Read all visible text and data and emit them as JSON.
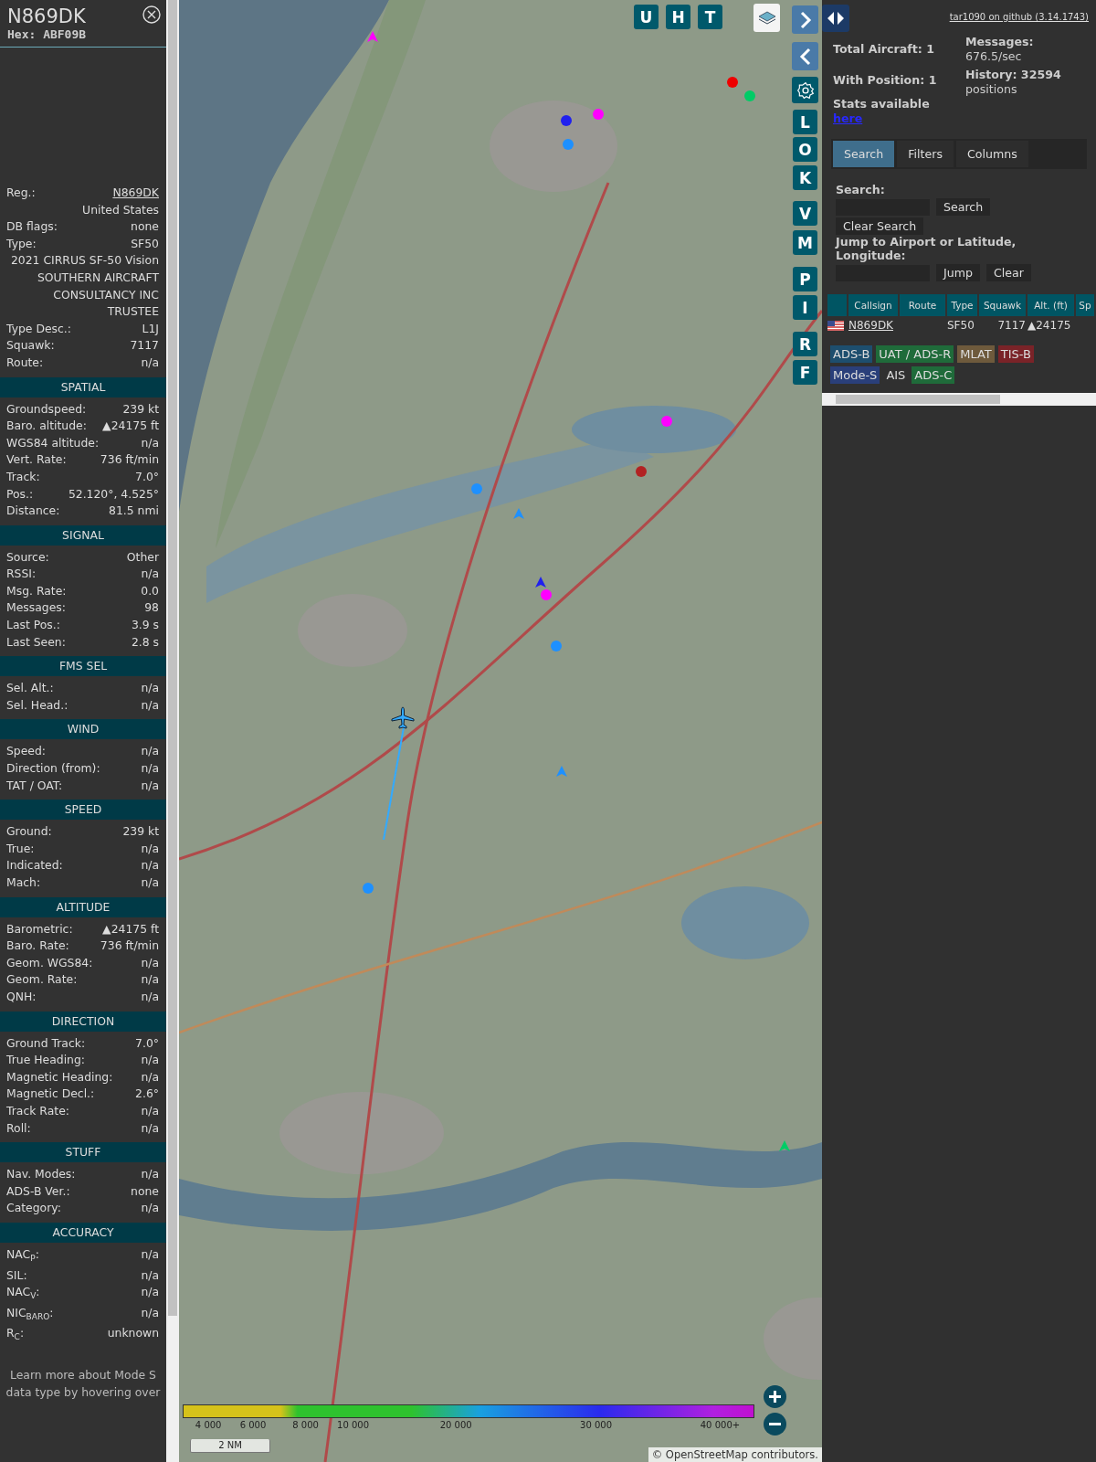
{
  "sidebar": {
    "title": "N869DK",
    "hex": "Hex: ABF09B",
    "sections": [
      {
        "rows": [
          {
            "label": "Reg.:",
            "value": "N869DK",
            "kind": "link"
          },
          {
            "value": "United States"
          },
          {
            "label": "DB flags:",
            "value": "none"
          },
          {
            "label": "Type:",
            "value": "SF50"
          },
          {
            "value": "2021 CIRRUS SF-50 Vision"
          },
          {
            "value": "SOUTHERN AIRCRAFT CONSULTANCY INC TRUSTEE"
          },
          {
            "label": "Type Desc.:",
            "value": "L1J"
          },
          {
            "label": "Squawk:",
            "value": "7117"
          },
          {
            "label": "Route:",
            "value": "n/a"
          }
        ]
      },
      {
        "heading": "SPATIAL",
        "rows": [
          {
            "label": "Groundspeed:",
            "value": "239 kt"
          },
          {
            "label": "Baro. altitude:",
            "value": "▲24175 ft"
          },
          {
            "label": "WGS84 altitude:",
            "value": "n/a"
          },
          {
            "label": "Vert. Rate:",
            "value": "736 ft/min"
          },
          {
            "label": "Track:",
            "value": "7.0°"
          },
          {
            "label": "Pos.:",
            "value": "52.120°, 4.525°"
          },
          {
            "label": "Distance:",
            "value": "81.5 nmi"
          }
        ]
      },
      {
        "heading": "SIGNAL",
        "rows": [
          {
            "label": "Source:",
            "value": "Other"
          },
          {
            "label": "RSSI:",
            "value": "n/a"
          },
          {
            "label": "Msg. Rate:",
            "value": "0.0"
          },
          {
            "label": "Messages:",
            "value": "98"
          },
          {
            "label": "Last Pos.:",
            "value": "3.9 s"
          },
          {
            "label": "Last Seen:",
            "value": "2.8 s"
          }
        ]
      },
      {
        "heading": "FMS SEL",
        "rows": [
          {
            "label": "Sel. Alt.:",
            "value": "n/a"
          },
          {
            "label": "Sel. Head.:",
            "value": "n/a"
          }
        ]
      },
      {
        "heading": "WIND",
        "rows": [
          {
            "label": "Speed:",
            "value": "n/a"
          },
          {
            "label": "Direction (from):",
            "value": "n/a"
          },
          {
            "label": "TAT / OAT:",
            "value": "n/a"
          }
        ]
      },
      {
        "heading": "SPEED",
        "rows": [
          {
            "label": "Ground:",
            "value": "239 kt"
          },
          {
            "label": "True:",
            "value": "n/a"
          },
          {
            "label": "Indicated:",
            "value": "n/a"
          },
          {
            "label": "Mach:",
            "value": "n/a"
          }
        ]
      },
      {
        "heading": "ALTITUDE",
        "rows": [
          {
            "label": "Barometric:",
            "value": "▲24175 ft"
          },
          {
            "label": "Baro. Rate:",
            "value": "736 ft/min"
          },
          {
            "label": "Geom. WGS84:",
            "value": "n/a"
          },
          {
            "label": "Geom. Rate:",
            "value": "n/a"
          },
          {
            "label": "QNH:",
            "value": "n/a"
          }
        ]
      },
      {
        "heading": "DIRECTION",
        "rows": [
          {
            "label": "Ground Track:",
            "value": "7.0°"
          },
          {
            "label": "True Heading:",
            "value": "n/a"
          },
          {
            "label": "Magnetic Heading:",
            "value": "n/a"
          },
          {
            "label": "Magnetic Decl.:",
            "value": "2.6°"
          },
          {
            "label": "Track Rate:",
            "value": "n/a"
          },
          {
            "label": "Roll:",
            "value": "n/a"
          }
        ]
      },
      {
        "heading": "STUFF",
        "rows": [
          {
            "label": "Nav. Modes:",
            "value": "n/a"
          },
          {
            "label": "ADS-B Ver.:",
            "value": "none"
          },
          {
            "label": "Category:",
            "value": "n/a"
          }
        ]
      },
      {
        "heading": "ACCURACY",
        "rows": [
          {
            "label": "NAC$_{P}$:",
            "value": "n/a"
          },
          {
            "label": "SIL:",
            "value": "n/a"
          },
          {
            "label": "NAC$_{V}$:",
            "value": "n/a"
          },
          {
            "label": "NIC$_{BARO}$:",
            "value": "n/a"
          },
          {
            "label": "R$_{C}$:",
            "value": "unknown"
          }
        ]
      }
    ],
    "footer": "Learn more about Mode S data type by hovering over"
  },
  "map": {
    "top_buttons": [
      "U",
      "H",
      "T"
    ],
    "side_buttons": [
      "L",
      "O",
      "K",
      "V",
      "M",
      "P",
      "I",
      "R",
      "F"
    ],
    "markers": [
      {
        "kind": "dot",
        "color": "#ff00ff"
      },
      {
        "kind": "dot",
        "color": "#1e90ff"
      },
      {
        "kind": "dot",
        "color": "#ee0000"
      },
      {
        "kind": "dot",
        "color": "#00cc66"
      },
      {
        "kind": "dot",
        "color": "#2020ee"
      },
      {
        "kind": "dot",
        "color": "#ff00ff"
      },
      {
        "kind": "plane",
        "color": "#1e90ff"
      },
      {
        "kind": "dot",
        "color": "#b22222"
      },
      {
        "kind": "plane",
        "color": "#ff00ff"
      },
      {
        "kind": "dot",
        "color": "#1e90ff"
      },
      {
        "kind": "plane",
        "color": "#2020ee"
      },
      {
        "kind": "dot",
        "color": "#ff00ff"
      },
      {
        "kind": "plane",
        "color": "#1e90ff"
      },
      {
        "kind": "dot",
        "color": "#1e90ff"
      },
      {
        "kind": "plane",
        "color": "#00cc66"
      },
      {
        "kind": "dot",
        "color": "#1e90ff"
      }
    ],
    "legend": [
      "4 000",
      "6 000",
      "8 000",
      "10 000",
      "20 000",
      "30 000",
      "40 000+"
    ],
    "scale": "2 NM",
    "attribution": "© OpenStreetMap contributors."
  },
  "panel": {
    "link": "tar1090 on github (3.14.1743)",
    "stats_left": [
      "Total Aircraft: 1",
      "With Position: 1",
      "Stats available"
    ],
    "stats_link": "here",
    "stats_right": [
      "Messages:",
      "676.5/sec",
      "History: 32594",
      "positions"
    ],
    "tabs": [
      {
        "label": "Search",
        "selected": true
      },
      {
        "label": "Filters",
        "selected": false
      },
      {
        "label": "Columns",
        "selected": false
      }
    ],
    "search_label": "Search:",
    "search_button": "Search",
    "clear_search": "Clear Search",
    "jump_label": "Jump to Airport or Latitude, Longitude:",
    "jump_button": "Jump",
    "clear_button": "Clear",
    "table": {
      "columns": [
        "Callsign",
        "Route",
        "Type",
        "Squawk",
        "Alt. (ft)",
        "Sp"
      ],
      "rows": [
        {
          "callsign": "N869DK",
          "type": "SF50",
          "squawk": "7117",
          "altitude": "▲24175"
        }
      ]
    },
    "sources": [
      {
        "label": "ADS-B",
        "color": "#1d4e6e"
      },
      {
        "label": "UAT / ADS-R",
        "color": "#1f6b3a"
      },
      {
        "label": "MLAT",
        "color": "#6e5a3c"
      },
      {
        "label": "TIS-B",
        "color": "#7a2328"
      },
      {
        "label": "Mode-S",
        "color": "#2a3f7a"
      },
      {
        "label": "AIS",
        "color": "#303030"
      },
      {
        "label": "ADS-C",
        "color": "#1f6b3a"
      }
    ]
  }
}
